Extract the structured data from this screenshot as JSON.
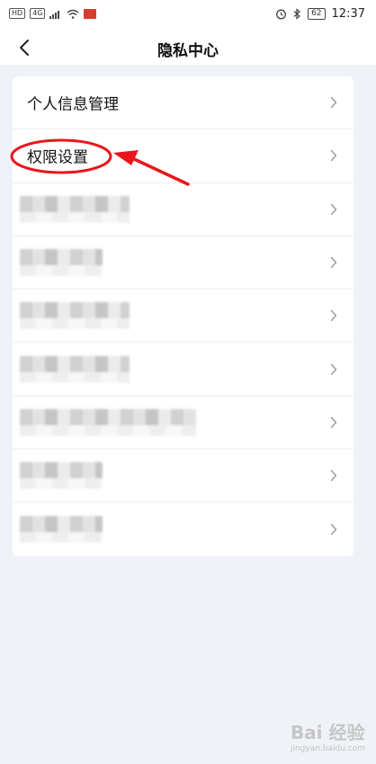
{
  "status_bar": {
    "badge_hd": "HD",
    "badge_4g": "4G",
    "battery": "62",
    "time": "12:37"
  },
  "nav": {
    "title": "隐私中心"
  },
  "list": {
    "items": [
      {
        "label": "个人信息管理"
      },
      {
        "label": "权限设置"
      }
    ],
    "redacted_count": 7
  },
  "annotation": {
    "color": "#e8161b"
  },
  "watermark": {
    "brand": "Bai 经验",
    "url": "jingyan.baidu.com"
  }
}
